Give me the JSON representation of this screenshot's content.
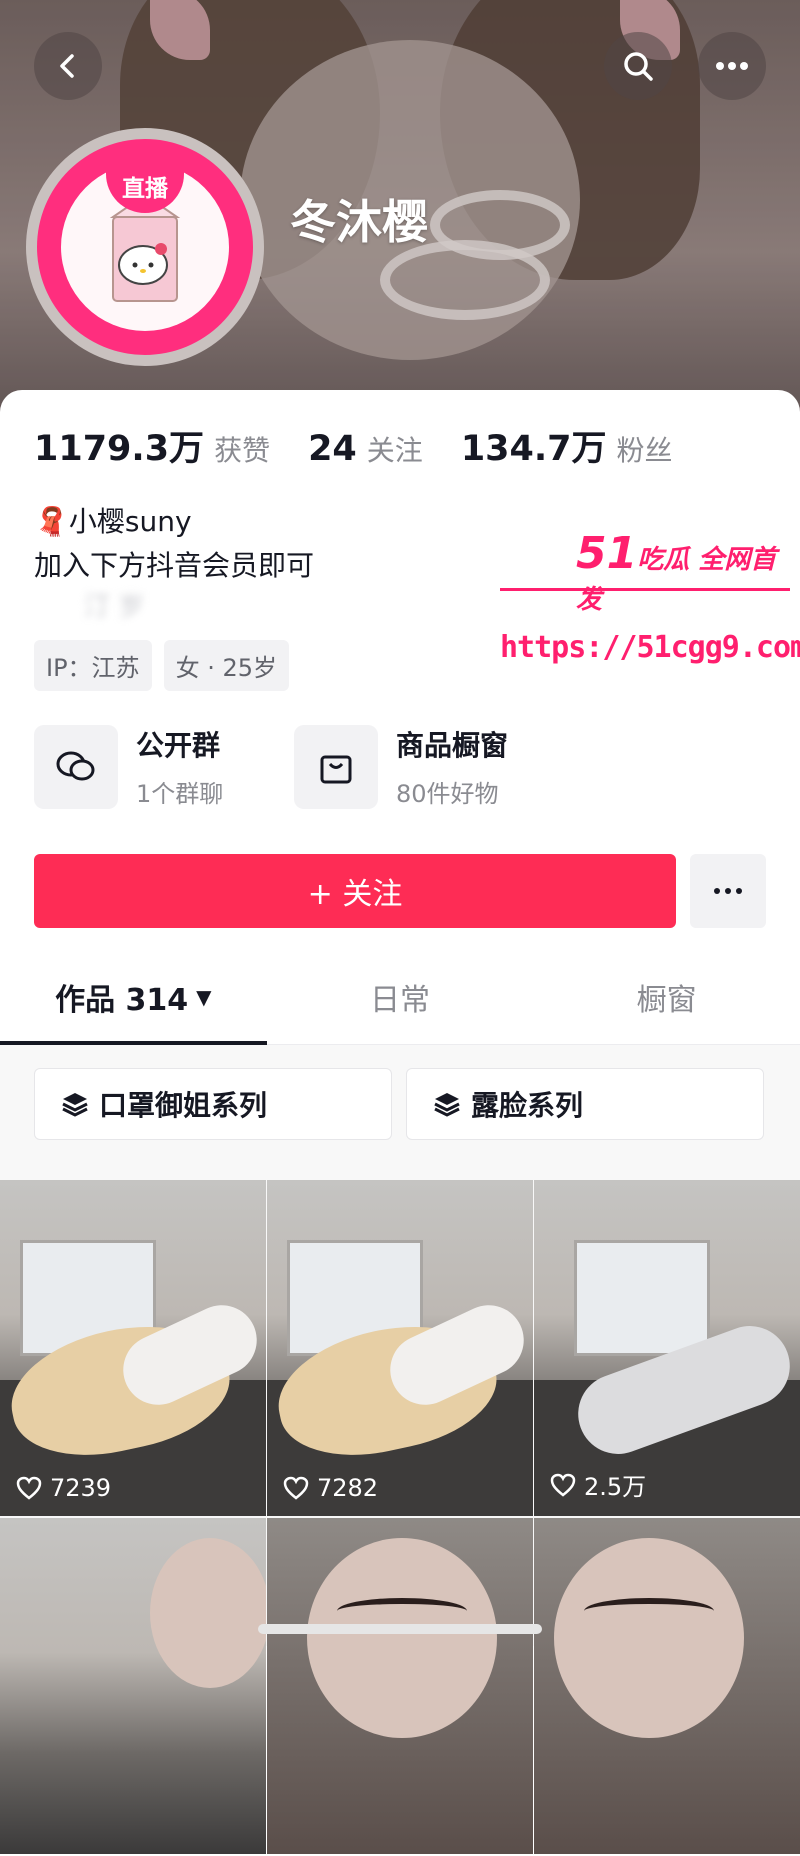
{
  "header": {
    "name": "冬沐樱",
    "live_badge": "直播"
  },
  "stats": [
    {
      "value": "1179.3万",
      "label": "获赞"
    },
    {
      "value": "24",
      "label": "关注"
    },
    {
      "value": "134.7万",
      "label": "粉丝"
    }
  ],
  "bio": {
    "line1": "小樱suny",
    "line2": "加入下方抖音会员即可",
    "line3_blurred": "汀 岁"
  },
  "tags": [
    "IP：江苏",
    "女 · 25岁"
  ],
  "features": [
    {
      "title": "公开群",
      "subtitle": "1个群聊",
      "icon": "chat-bubbles-icon"
    },
    {
      "title": "商品橱窗",
      "subtitle": "80件好物",
      "icon": "shopping-bag-icon"
    }
  ],
  "follow": {
    "label": "+ 关注"
  },
  "tabs": [
    {
      "label": "作品 314",
      "active": true
    },
    {
      "label": "日常",
      "active": false
    },
    {
      "label": "橱窗",
      "active": false
    }
  ],
  "collections": [
    "口罩御姐系列",
    "露脸系列"
  ],
  "videos": [
    {
      "likes": "7239"
    },
    {
      "likes": "7282"
    },
    {
      "likes": "2.5万"
    },
    {
      "likes": ""
    },
    {
      "likes": ""
    },
    {
      "likes": ""
    }
  ],
  "watermark": {
    "brand_num": "51",
    "brand_text": "吃瓜 全网首发",
    "url": "https://51cgg9.com"
  },
  "colors": {
    "accent": "#fe2c55",
    "live_pink": "#ff2e7e",
    "text": "#161823",
    "muted": "#8a8b91"
  }
}
